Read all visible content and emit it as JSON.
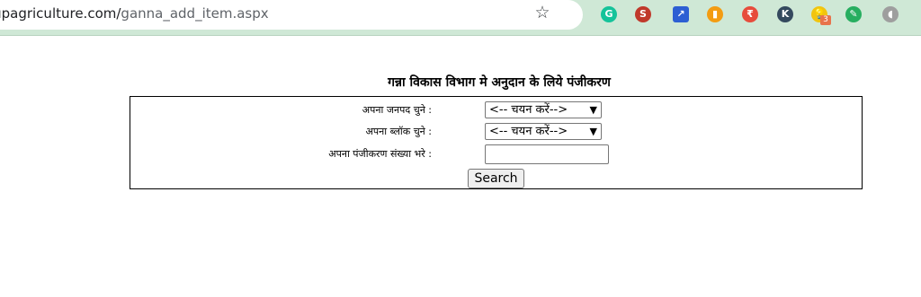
{
  "browser": {
    "url_host": "//upagriculture.com/",
    "url_path": "ganna_add_item.aspx",
    "extensions": [
      {
        "name": "grammarly-icon",
        "glyph": "G",
        "color": "#15c39a"
      },
      {
        "name": "seo-icon",
        "glyph": "S",
        "color": "#c0392b"
      },
      {
        "name": "analytics-icon",
        "glyph": "↗",
        "color": "#2d5fd3"
      },
      {
        "name": "chart-icon",
        "glyph": "▮",
        "color": "#f39c12"
      },
      {
        "name": "price-tag-icon",
        "glyph": "₹",
        "color": "#e74c3c"
      },
      {
        "name": "k-icon",
        "glyph": "K",
        "color": "#34495e"
      },
      {
        "name": "lightbulb-icon",
        "glyph": "💡",
        "color": "#f1c40f"
      },
      {
        "name": "brush-icon",
        "glyph": "✎",
        "color": "#27ae60"
      },
      {
        "name": "profile-icon",
        "glyph": "◖",
        "color": "#9e9e9e"
      }
    ],
    "badge_count": "3"
  },
  "page": {
    "title": "गन्ना विकास विभाग मे अनुदान के लिये पंजीकरण",
    "district_label": "अपना जनपद चुने :",
    "district_value": "<-- चयन करें-->",
    "block_label": "अपना ब्लॉक चुने :",
    "block_value": "<-- चयन करें-->",
    "registration_label": "अपना पंजीकरण संख्या भरे :",
    "registration_value": "",
    "search_label": "Search"
  }
}
